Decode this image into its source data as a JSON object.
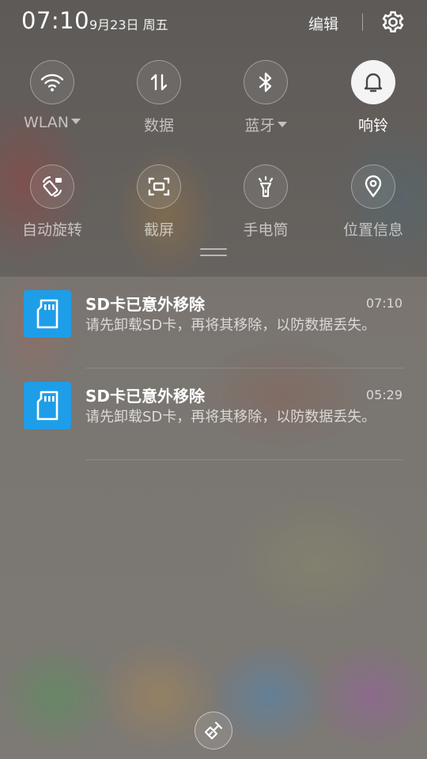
{
  "status_bar": {
    "time": "07:10",
    "date": "9月23日 周五",
    "edit_label": "编辑",
    "settings_icon": "gear-icon"
  },
  "quick_settings": {
    "row1": [
      {
        "label": "WLAN",
        "icon": "wifi-icon",
        "has_dropdown": true,
        "active": false
      },
      {
        "label": "数据",
        "icon": "mobile-data-icon",
        "has_dropdown": false,
        "active": false
      },
      {
        "label": "蓝牙",
        "icon": "bluetooth-icon",
        "has_dropdown": true,
        "active": false
      },
      {
        "label": "响铃",
        "icon": "bell-icon",
        "has_dropdown": false,
        "active": true
      }
    ],
    "row2": [
      {
        "label": "自动旋转",
        "icon": "auto-rotate-icon",
        "active": false
      },
      {
        "label": "截屏",
        "icon": "screenshot-icon",
        "active": false
      },
      {
        "label": "手电筒",
        "icon": "flashlight-icon",
        "active": false
      },
      {
        "label": "位置信息",
        "icon": "location-icon",
        "active": false
      }
    ]
  },
  "notifications": [
    {
      "icon": "sd-card-icon",
      "title": "SD卡已意外移除",
      "time": "07:10",
      "body": "请先卸载SD卡，再将其移除，以防数据丢失。"
    },
    {
      "icon": "sd-card-icon",
      "title": "SD卡已意外移除",
      "time": "05:29",
      "body": "请先卸载SD卡，再将其移除，以防数据丢失。"
    }
  ],
  "clear_button_icon": "clear-all-broom-icon",
  "colors": {
    "accent_icon_bg": "#1e9ee8",
    "active_tile_bg": "#f4f4f4"
  }
}
